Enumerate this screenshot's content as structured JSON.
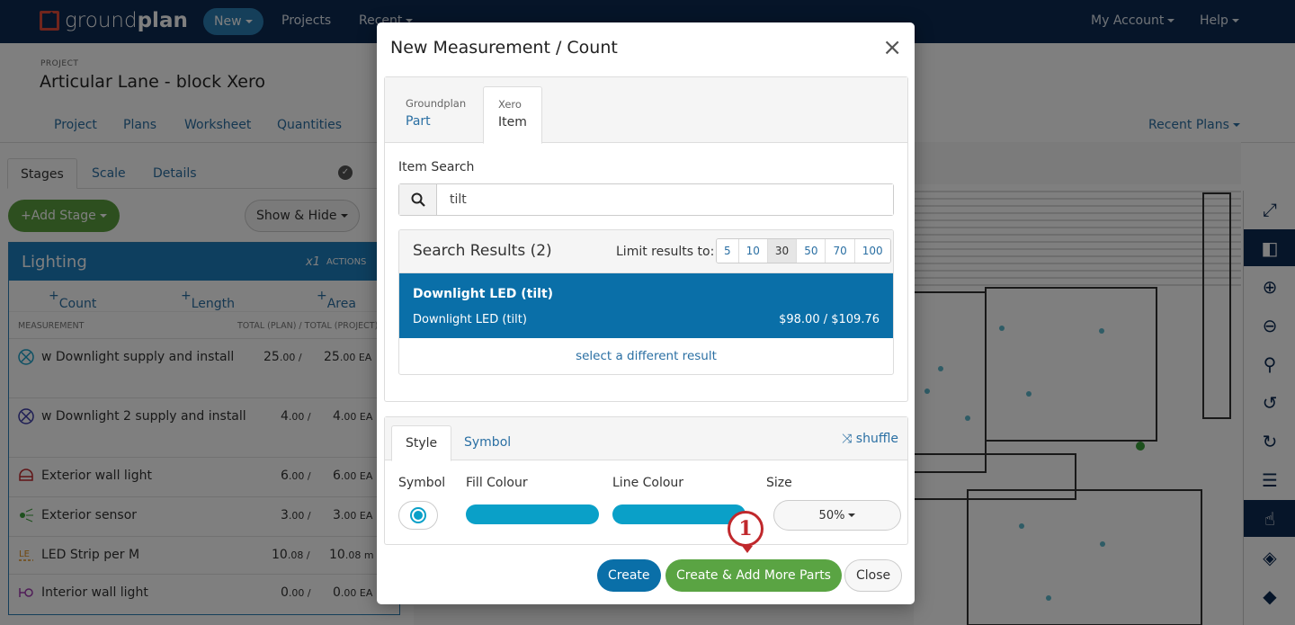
{
  "nav": {
    "logo_a": "ground",
    "logo_b": "plan",
    "new_label": "New",
    "projects": "Projects",
    "recent": "Recent",
    "account": "My Account",
    "help": "Help"
  },
  "project": {
    "small_label": "PROJECT",
    "title": "Articular Lane - block Xero",
    "tabs": [
      "Project",
      "Plans",
      "Worksheet",
      "Quantities"
    ],
    "recent_plans": "Recent Plans"
  },
  "left": {
    "tabs": [
      "Stages",
      "Scale",
      "Details"
    ],
    "add_stage": "Add Stage",
    "show_hide": "Show & Hide",
    "stage_name": "Lighting",
    "multiplier": "x1",
    "actions": "ACTIONS",
    "add_buttons": [
      "Count",
      "Length",
      "Area"
    ],
    "col_measurement": "MEASUREMENT",
    "col_total": "TOTAL (PLAN) / TOTAL (PROJECT)",
    "rows": [
      {
        "name": "w Downlight supply and install",
        "v1": "25",
        "v1s": ".00 /",
        "v2": "25",
        "v2s": ".00 EA",
        "icon": "crossed-circle-icon",
        "color": "#1aa0c8"
      },
      {
        "name": "w Downlight 2 supply and install",
        "v1": "4",
        "v1s": ".00 /",
        "v2": "4",
        "v2s": ".00 EA",
        "icon": "crossed-circle-icon",
        "color": "#3a3aa8"
      },
      {
        "name": "Exterior wall light",
        "v1": "6",
        "v1s": ".00 /",
        "v2": "6",
        "v2s": ".00 EA",
        "icon": "wall-light-icon",
        "color": "#c0282c"
      },
      {
        "name": "Exterior sensor",
        "v1": "3",
        "v1s": ".00 /",
        "v2": "3",
        "v2s": ".00 EA",
        "icon": "sensor-icon",
        "color": "#3aa03a"
      },
      {
        "name": "LED Strip per M",
        "v1": "10",
        "v1s": ".08 /",
        "v2": "10",
        "v2s": ".08 m",
        "icon": "led-strip-icon",
        "color": "#e09020"
      },
      {
        "name": "Interior wall light",
        "v1": "0",
        "v1s": ".00 /",
        "v2": "0",
        "v2s": ".00 EA",
        "icon": "interior-light-icon",
        "color": "#a03ab0"
      }
    ]
  },
  "modal": {
    "title": "New Measurement / Count",
    "tab1_sub": "Groundplan",
    "tab1_main": "Part",
    "tab2_sub": "Xero",
    "tab2_main": "Item",
    "search_label": "Item Search",
    "search_value": "tilt",
    "results_title": "Search Results (2)",
    "limit_label": "Limit results to:",
    "limits": [
      "5",
      "10",
      "30",
      "50",
      "70",
      "100"
    ],
    "selected_limit": "30",
    "selected_title": "Downlight LED (tilt)",
    "selected_sub": "Downlight LED (tilt)",
    "selected_price": "$98.00 / $109.76",
    "different": "select a different result",
    "style_tab": "Style",
    "symbol_tab": "Symbol",
    "shuffle": "shuffle",
    "symbol_label": "Symbol",
    "fill_label": "Fill Colour",
    "line_label": "Line Colour",
    "size_label": "Size",
    "size_value": "50%",
    "fill_color": "#0aa0c8",
    "line_color": "#0aa0c8",
    "btn_create": "Create",
    "btn_more": "Create & Add More Parts",
    "btn_close": "Close",
    "callout": "1"
  }
}
